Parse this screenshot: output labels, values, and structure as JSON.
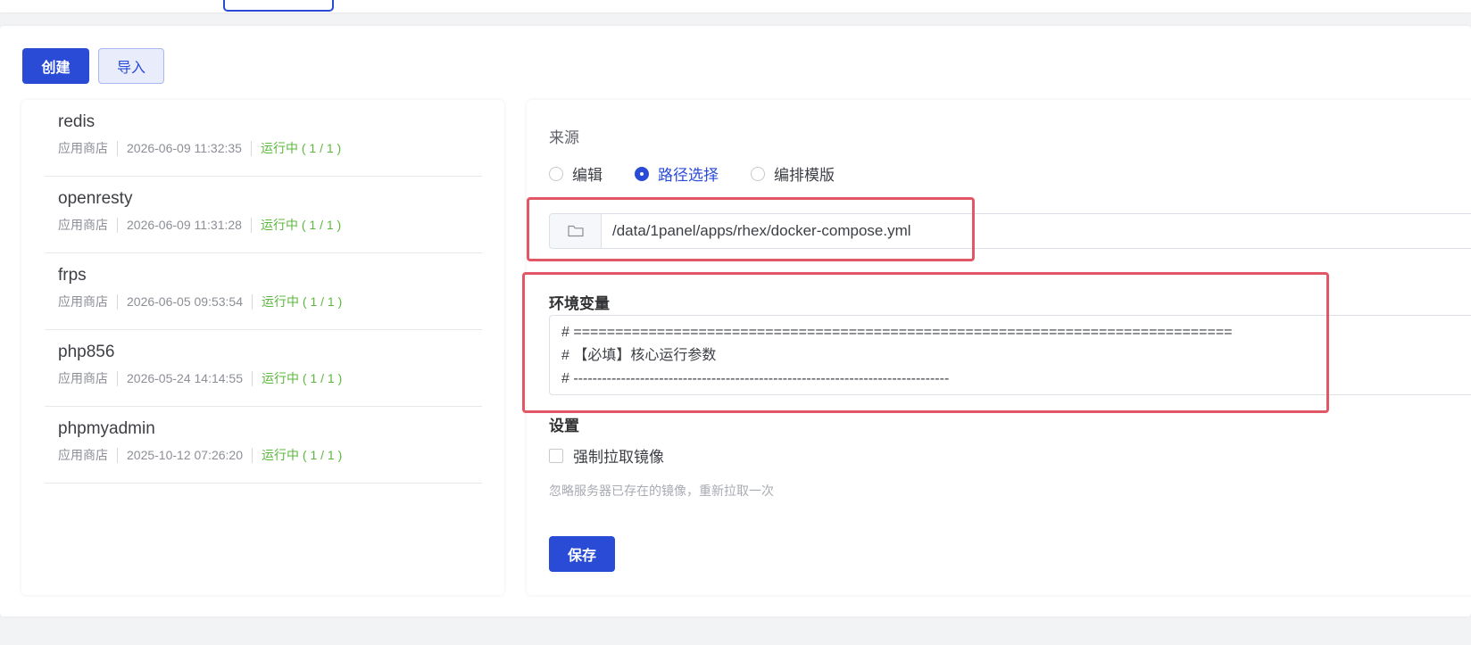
{
  "toolbar": {
    "create_label": "创建",
    "import_label": "导入"
  },
  "apps": [
    {
      "name": "redis",
      "source": "应用商店",
      "time": "2026-06-09 11:32:35",
      "status": "运行中 ( 1 / 1 )"
    },
    {
      "name": "openresty",
      "source": "应用商店",
      "time": "2026-06-09 11:31:28",
      "status": "运行中 ( 1 / 1 )"
    },
    {
      "name": "frps",
      "source": "应用商店",
      "time": "2026-06-05 09:53:54",
      "status": "运行中 ( 1 / 1 )"
    },
    {
      "name": "php856",
      "source": "应用商店",
      "time": "2026-05-24 14:14:55",
      "status": "运行中 ( 1 / 1 )"
    },
    {
      "name": "phpmyadmin",
      "source": "应用商店",
      "time": "2025-10-12 07:26:20",
      "status": "运行中 ( 1 / 1 )"
    }
  ],
  "form": {
    "source_label": "来源",
    "source_options": [
      "编辑",
      "路径选择",
      "编排模版"
    ],
    "source_selected": "路径选择",
    "path_value": "/data/1panel/apps/rhex/docker-compose.yml",
    "env_label": "环境变量",
    "env_lines": [
      "# ===============================================================================",
      "# 【必填】核心运行参数",
      "# -------------------------------------------------------------------------------"
    ],
    "settings_label": "设置",
    "force_pull_label": "强制拉取镜像",
    "force_pull_checked": false,
    "force_pull_hint": "忽略服务器已存在的镜像，重新拉取一次",
    "save_label": "保存"
  },
  "icons": {
    "path_prefix": "folder-icon"
  },
  "colors": {
    "primary": "#2a4bd6",
    "status_running": "#5cb83c",
    "highlight": "#e25766"
  }
}
